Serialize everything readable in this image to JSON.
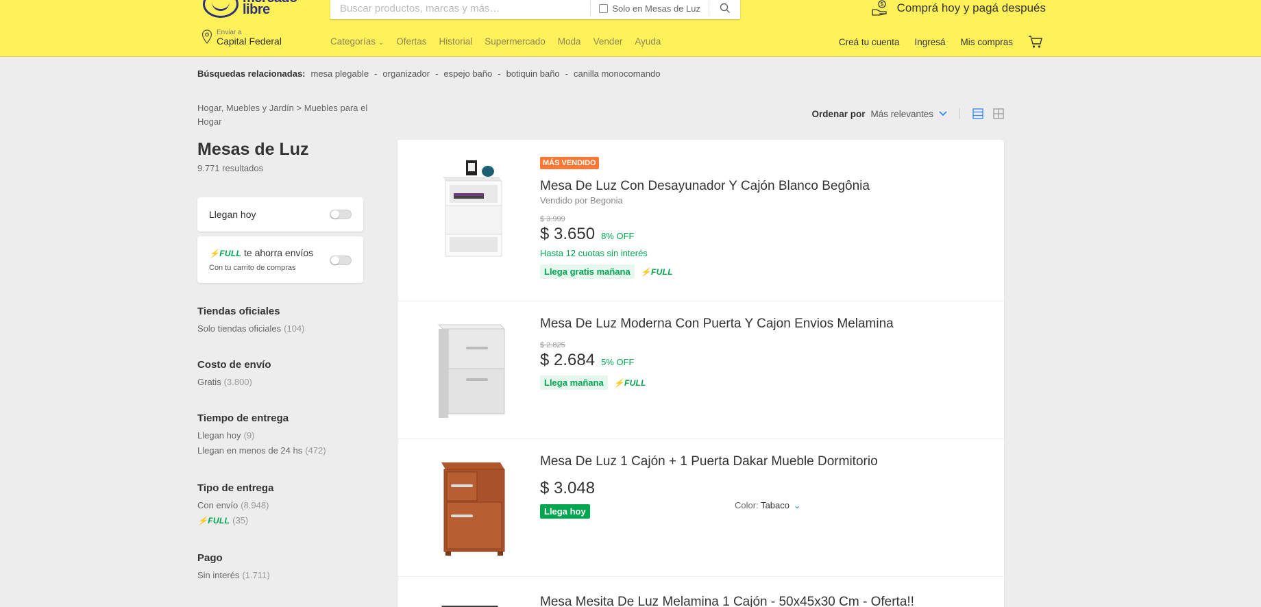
{
  "header": {
    "logo_text_line1": "mercado",
    "logo_text_line2": "libre",
    "search_placeholder": "Buscar productos, marcas y más…",
    "search_checkbox_label": "Solo en Mesas de Luz",
    "promo_text": "Comprá hoy y pagá después",
    "location_small": "Enviar a",
    "location_big": "Capital Federal",
    "nav": [
      "Categorías",
      "Ofertas",
      "Historial",
      "Supermercado",
      "Moda",
      "Vender",
      "Ayuda"
    ],
    "user_nav": [
      "Creá tu cuenta",
      "Ingresá",
      "Mis compras"
    ],
    "brand_color": "#fff159"
  },
  "related": {
    "label": "Búsquedas relacionadas:",
    "items": [
      "mesa plegable",
      "organizador",
      "espejo baño",
      "botiquin baño",
      "canilla monocomando"
    ]
  },
  "breadcrumb": {
    "part1": "Hogar, Muebles y Jardín",
    "part2": "Muebles para el Hogar"
  },
  "sort": {
    "label": "Ordenar por",
    "value": "Más relevantes"
  },
  "sidebar": {
    "title": "Mesas de Luz",
    "count": "9.771 resultados",
    "toggle_today": "Llegan hoy",
    "full_word": "FULL",
    "toggle_full_text": "te ahorra envíos",
    "toggle_full_sub": "Con tu carrito de compras",
    "sections": [
      {
        "title": "Tiendas oficiales",
        "items": [
          {
            "label": "Solo tiendas oficiales",
            "qty": "(104)"
          }
        ]
      },
      {
        "title": "Costo de envío",
        "items": [
          {
            "label": "Gratis",
            "qty": "(3.800)"
          }
        ]
      },
      {
        "title": "Tiempo de entrega",
        "items": [
          {
            "label": "Llegan hoy",
            "qty": "(9)"
          },
          {
            "label": "Llegan en menos de 24 hs",
            "qty": "(472)"
          }
        ]
      },
      {
        "title": "Tipo de entrega",
        "items": [
          {
            "label": "Con envío",
            "qty": "(8.948)"
          },
          {
            "label": "FULL",
            "qty": "(35)"
          }
        ]
      },
      {
        "title": "Pago",
        "items": [
          {
            "label": "Sin interés",
            "qty": "(1.711)"
          }
        ]
      }
    ]
  },
  "results": [
    {
      "badge": "MÁS VENDIDO",
      "title": "Mesa De Luz Con Desayunador Y Cajón Blanco Begônia",
      "seller": "Vendido por Begonia",
      "old_price": "$ 3.999",
      "price": "$ 3.650",
      "off": "8% OFF",
      "installments": "Hasta 12 cuotas sin interés",
      "shipping": "Llega gratis mañana",
      "full": "FULL"
    },
    {
      "title": "Mesa De Luz Moderna Con Puerta Y Cajon Envios Melamina",
      "old_price": "$ 2.825",
      "price": "$ 2.684",
      "off": "5% OFF",
      "shipping": "Llega mañana",
      "full": "FULL"
    },
    {
      "title": "Mesa De Luz 1 Cajón + 1 Puerta Dakar Mueble Dormitorio",
      "price": "$ 3.048",
      "shipping_today": "Llega hoy",
      "color_label": "Color:",
      "color_value": "Tabaco"
    },
    {
      "title": "Mesa Mesita De Luz Melamina 1 Cajón - 50x45x30 Cm - Oferta!!"
    }
  ]
}
